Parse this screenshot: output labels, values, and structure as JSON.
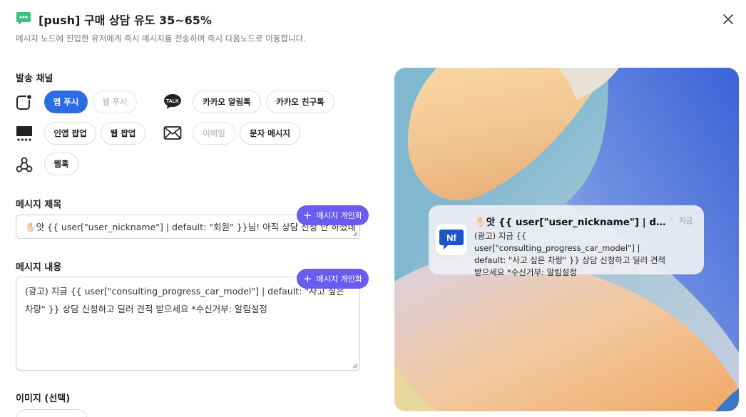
{
  "header": {
    "title": "[push] 구매 상담 유도 35~65%",
    "subtitle": "메시지 노드에 진입한 유저에게 즉시 메시지를 전송하며 즉시 다음노드로 이동합니다."
  },
  "channels": {
    "label": "발송 채널",
    "app_push": "앱 푸시",
    "web_push": "웹 푸시",
    "kakao_alimtalk": "카카오 알림톡",
    "kakao_friendtalk": "카카오 친구톡",
    "inapp_popup": "인앱 팝업",
    "web_popup": "웹 팝업",
    "email": "이메일",
    "sms": "문자 메시지",
    "webhook": "웹훅",
    "talk_badge": "TALK"
  },
  "message_title": {
    "label": "메시지 제목",
    "value": "✋🏻앗 {{ user[\"user_nickname\"] | default: \"회원\" }}님! 아직 상담 신청 안 하셨네",
    "personalize": "메시지 개인화"
  },
  "message_body": {
    "label": "메시지 내용",
    "value": "(광고) 지금 {{ user[\"consulting_progress_car_model\"] | default: \"사고 싶은 차량\" }} 상담 신청하고 딜러 견적 받으세요 *수신거부: 알림설정",
    "personalize": "메시지 개인화"
  },
  "image": {
    "label": "이미지 (선택)"
  },
  "preview": {
    "app_icon_text": "Nf",
    "title": "✋🏻앗 {{ user[\"user_nickname\"] | default...",
    "time": "지금",
    "body": "(광고) 지금 {{ user[\"consulting_progress_car_model\"] | default: \"사고 싶은 차량\" }} 상담 신청하고 딜러 견적 받으세요 *수신거부: 알림설정"
  },
  "colors": {
    "accent": "#2d6be4",
    "personalize": "#6a5cf0",
    "header_icon": "#3cc27a"
  }
}
